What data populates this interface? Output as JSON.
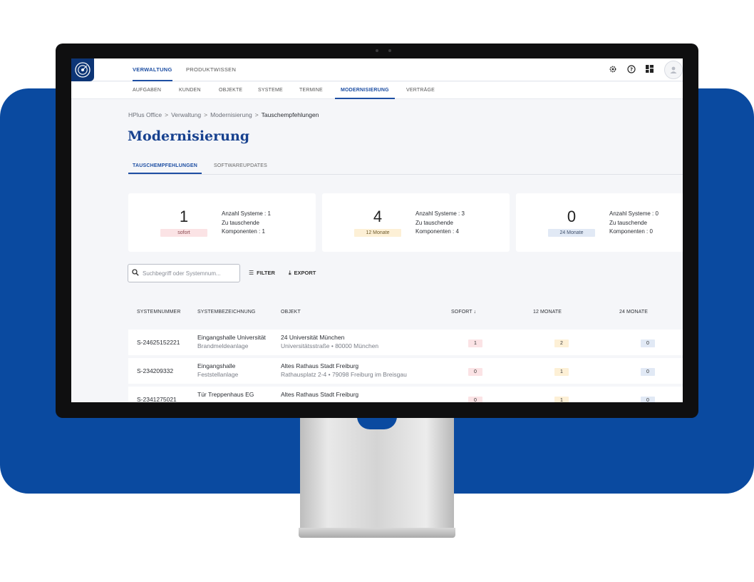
{
  "colors": {
    "brand": "#0a4aa0",
    "accent": "#1e4fa3",
    "pill_sofort": "#fbe3e5",
    "pill_12": "#fdf0d6",
    "pill_24": "#e1e9f5"
  },
  "header": {
    "tabs": [
      {
        "label": "VERWALTUNG"
      },
      {
        "label": "PRODUKTWISSEN"
      }
    ],
    "icons": [
      "gear-icon",
      "help-icon",
      "grid-icon",
      "user-avatar-icon"
    ]
  },
  "subnav": {
    "items": [
      {
        "label": "AUFGABEN"
      },
      {
        "label": "KUNDEN"
      },
      {
        "label": "OBJEKTE"
      },
      {
        "label": "SYSTEME"
      },
      {
        "label": "TERMINE"
      },
      {
        "label": "MODERNISIERUNG"
      },
      {
        "label": "VERTRÄGE"
      }
    ]
  },
  "breadcrumb": [
    "HPlus Office",
    "Verwaltung",
    "Modernisierung",
    "Tauschempfehlungen"
  ],
  "page": {
    "title": "Modernisierung"
  },
  "page_tabs": [
    {
      "label": "TAUSCHEMPFEHLUNGEN"
    },
    {
      "label": "SOFTWAREUPDATES"
    }
  ],
  "cards": [
    {
      "count": "1",
      "badge": "sofort",
      "line1": "Anzahl Systeme : 1",
      "line2": "Zu tauschende",
      "line3": "Komponenten : 1"
    },
    {
      "count": "4",
      "badge": "12 Monate",
      "line1": "Anzahl Systeme : 3",
      "line2": "Zu tauschende",
      "line3": "Komponenten : 4"
    },
    {
      "count": "0",
      "badge": "24 Monate",
      "line1": "Anzahl Systeme : 0",
      "line2": "Zu tauschende",
      "line3": "Komponenten : 0"
    }
  ],
  "toolbar": {
    "search_placeholder": "Suchbegriff oder Systemnum...",
    "filter_label": "FILTER",
    "export_label": "EXPORT"
  },
  "table": {
    "headers": [
      "SYSTEMNUMMER",
      "SYSTEMBEZEICHNUNG",
      "OBJEKT",
      "SOFORT ↓",
      "12 MONATE",
      "24 MONATE"
    ],
    "rows": [
      {
        "nummer": "S-24625152221",
        "bez": "Eingangshalle Universität",
        "bez_sub": "Brandmeldeanlage",
        "objekt": "24 Universität München",
        "objekt_sub": "Universitätsstraße • 80000 München",
        "sofort": "1",
        "m12": "2",
        "m24": "0"
      },
      {
        "nummer": "S-234209332",
        "bez": "Eingangshalle",
        "bez_sub": "Feststellanlage",
        "objekt": "Altes Rathaus Stadt Freiburg",
        "objekt_sub": "Rathausplatz 2-4 • 79098 Freiburg im Breisgau",
        "sofort": "0",
        "m12": "1",
        "m24": "0"
      },
      {
        "nummer": "S-2341275021",
        "bez": "Tür Treppenhaus EG",
        "bez_sub": "",
        "objekt": "Altes Rathaus Stadt Freiburg",
        "objekt_sub": "",
        "sofort": "0",
        "m12": "1",
        "m24": "0"
      }
    ]
  }
}
